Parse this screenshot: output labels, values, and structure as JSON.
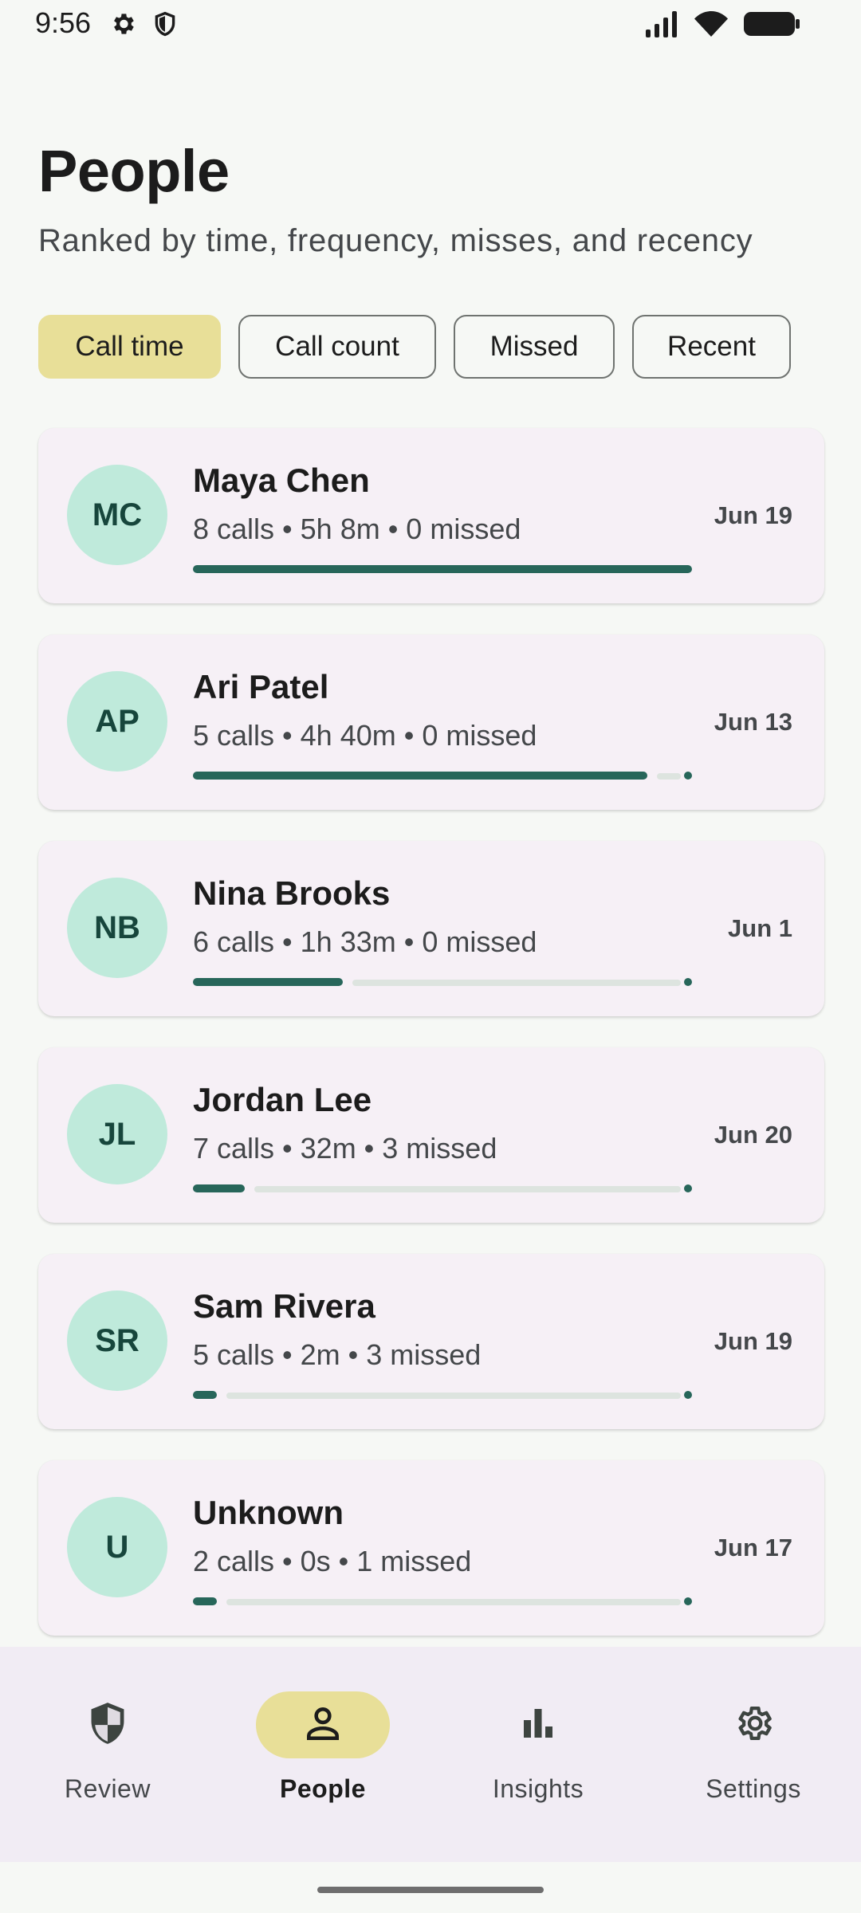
{
  "status_bar": {
    "time": "9:56"
  },
  "header": {
    "title": "People",
    "subtitle": "Ranked by time, frequency, misses, and recency"
  },
  "filters": [
    {
      "label": "Call time",
      "selected": true
    },
    {
      "label": "Call count",
      "selected": false
    },
    {
      "label": "Missed",
      "selected": false
    },
    {
      "label": "Recent",
      "selected": false
    }
  ],
  "people": [
    {
      "initials": "MC",
      "name": "Maya Chen",
      "stats": "8 calls • 5h 8m • 0 missed",
      "date": "Jun 19",
      "share": 1.0
    },
    {
      "initials": "AP",
      "name": "Ari Patel",
      "stats": "5 calls • 4h 40m • 0 missed",
      "date": "Jun 13",
      "share": 0.91
    },
    {
      "initials": "NB",
      "name": "Nina Brooks",
      "stats": "6 calls • 1h 33m • 0 missed",
      "date": "Jun 1",
      "share": 0.3
    },
    {
      "initials": "JL",
      "name": "Jordan Lee",
      "stats": "7 calls • 32m • 3 missed",
      "date": "Jun 20",
      "share": 0.104
    },
    {
      "initials": "SR",
      "name": "Sam Rivera",
      "stats": "5 calls • 2m • 3 missed",
      "date": "Jun 19",
      "share": 0.006
    },
    {
      "initials": "U",
      "name": "Unknown",
      "stats": "2 calls • 0s • 1 missed",
      "date": "Jun 17",
      "share": 0.0
    }
  ],
  "bottom_nav": [
    {
      "label": "Review",
      "icon": "shield-icon",
      "active": false
    },
    {
      "label": "People",
      "icon": "person-icon",
      "active": true
    },
    {
      "label": "Insights",
      "icon": "bar-chart-icon",
      "active": false
    },
    {
      "label": "Settings",
      "icon": "gear-icon",
      "active": false
    }
  ],
  "colors": {
    "accent": "#27665a",
    "selected_chip": "#e8df98",
    "avatar_bg": "#bfeadb",
    "card_bg": "#f6f0f6"
  }
}
